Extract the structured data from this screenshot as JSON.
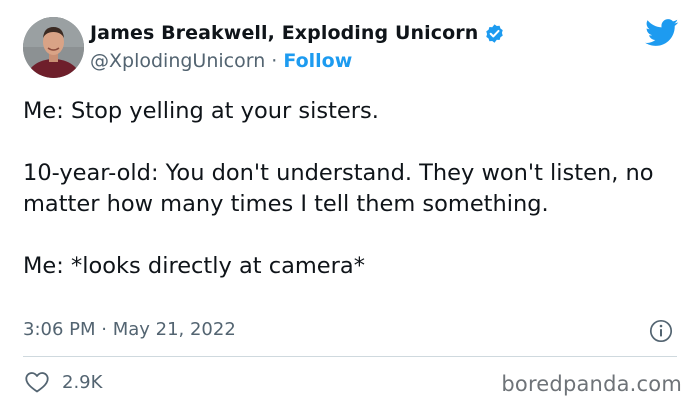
{
  "author": {
    "name": "James Breakwell, Exploding Unicorn",
    "handle": "@XplodingUnicorn",
    "separator": "·",
    "follow_label": "Follow",
    "verified": true
  },
  "tweet": {
    "lines": [
      "Me: Stop yelling at your sisters.",
      "10-year-old: You don't understand. They won't listen, no matter how many times I tell them something.",
      "Me: *looks directly at camera*"
    ],
    "timestamp": "3:06 PM · May 21, 2022"
  },
  "engagement": {
    "likes": "2.9K"
  },
  "watermark": "boredpanda.com",
  "icons": {
    "brand": "twitter-bird-icon",
    "verified": "verified-badge-icon",
    "info": "info-icon",
    "like": "heart-icon"
  },
  "colors": {
    "accent": "#1d9bf0",
    "text": "#0f1419",
    "secondary": "#536471",
    "divider": "#cfd9de"
  }
}
